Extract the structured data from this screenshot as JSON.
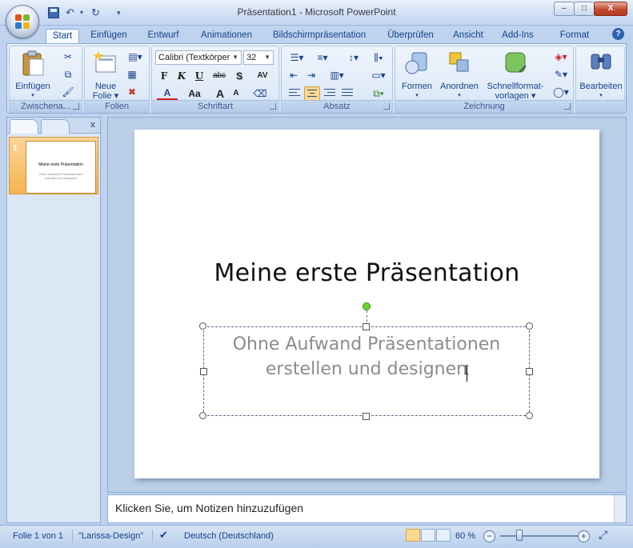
{
  "window": {
    "title": "Präsentation1 - Microsoft PowerPoint",
    "minimize": "–",
    "maximize": "□",
    "close": "X"
  },
  "qat": {
    "undo": "↶",
    "undo_drop": "▾",
    "redo": "↻",
    "customize": "▾"
  },
  "tabs": [
    {
      "label": "Start",
      "active": true
    },
    {
      "label": "Einfügen"
    },
    {
      "label": "Entwurf"
    },
    {
      "label": "Animationen"
    },
    {
      "label": "Bildschirmpräsentation"
    },
    {
      "label": "Überprüfen"
    },
    {
      "label": "Ansicht"
    },
    {
      "label": "Add-Ins"
    },
    {
      "label": "Format"
    }
  ],
  "help": "?",
  "ribbon": {
    "groups": {
      "clipboard": "Zwischena...",
      "slides": "Folien",
      "font": "Schriftart",
      "paragraph": "Absatz",
      "drawing": "Zeichnung",
      "editing": ""
    },
    "paste": "Einfügen",
    "new_slide_1": "Neue",
    "new_slide_2": "Folie ▾",
    "font_name": "Calibri (Textkörper",
    "font_size": "32",
    "bold": "F",
    "italic": "K",
    "underline": "U",
    "strike": "abc",
    "shadow": "S",
    "spacing": "AV",
    "font_color": "A",
    "change_case": "Aa",
    "grow": "A",
    "shrink": "A",
    "shapes": "Formen",
    "arrange": "Anordnen",
    "quickstyles_1": "Schnellformat-",
    "quickstyles_2": "vorlagen ▾",
    "edit": "Bearbeiten"
  },
  "thumbnails": [
    {
      "number": "1",
      "title": "Meine erste Präsentation",
      "subtitle": "Ohne Aufwand Präsentationen erstellen und designen"
    }
  ],
  "slide": {
    "title": "Meine erste Präsentation",
    "subtitle_line1": "Ohne Aufwand Präsentationen",
    "subtitle_line2": "erstellen und designen"
  },
  "notes": {
    "placeholder": "Klicken Sie, um  Notizen hinzuzufügen"
  },
  "status": {
    "slide_info": "Folie 1 von 1",
    "theme": "\"Larissa-Design\"",
    "language": "Deutsch (Deutschland)",
    "zoom": "60 %"
  },
  "colors": {
    "accent": "#15428b",
    "ribbon": "#dbe8f7",
    "thumb_selected": "#f5b44f"
  }
}
